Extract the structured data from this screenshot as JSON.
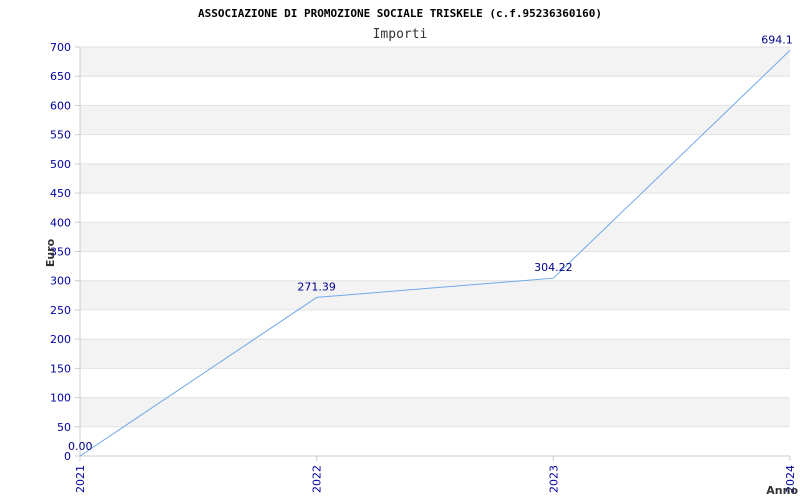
{
  "chart_data": {
    "type": "line",
    "title": "ASSOCIAZIONE DI PROMOZIONE SOCIALE TRISKELE (c.f.95236360160)",
    "subtitle": "Importi",
    "xlabel": "Anno",
    "ylabel": "Euro",
    "categories": [
      "2021",
      "2022",
      "2023",
      "2024"
    ],
    "series": [
      {
        "values": [
          0.0,
          271.39,
          304.22,
          694.1
        ],
        "labels": [
          "0.00",
          "271.39",
          "304.22",
          "694.1"
        ]
      }
    ],
    "ylim": [
      0,
      700
    ],
    "yticks": [
      "0",
      "50",
      "100",
      "150",
      "200",
      "250",
      "300",
      "350",
      "400",
      "450",
      "500",
      "550",
      "600",
      "650",
      "700"
    ],
    "grid": true,
    "band_colors": [
      "#f3f3f3",
      "#ffffff"
    ],
    "line_color": "#70a8ea",
    "axis_color": "#cccccc",
    "tick_label_color": "#0000a0",
    "data_label_color": "#00008b"
  }
}
